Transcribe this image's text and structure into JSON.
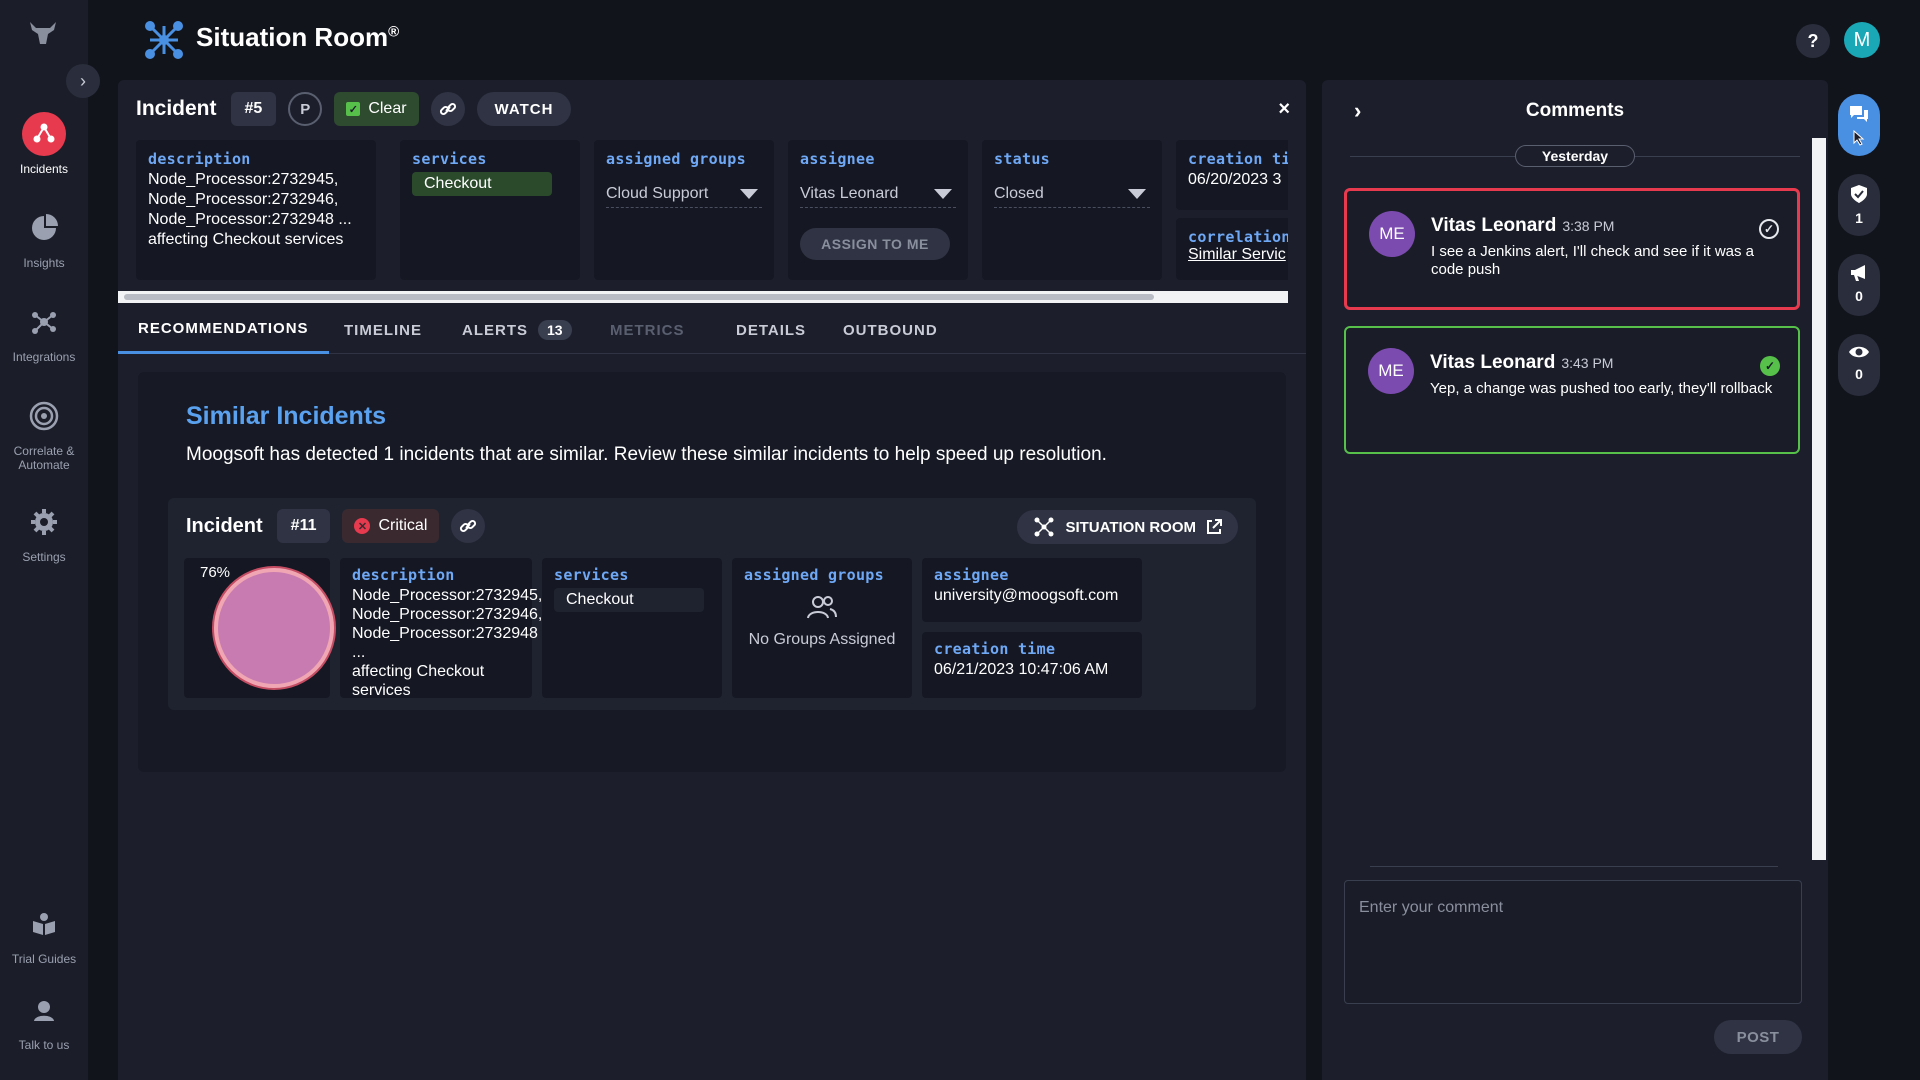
{
  "app": {
    "title": "Situation Room",
    "trademark": "®",
    "help_label": "?",
    "user_initial": "M"
  },
  "nav": {
    "items": [
      {
        "label": "Incidents",
        "icon": "incidents-icon",
        "active": true
      },
      {
        "label": "Insights",
        "icon": "pie-chart-icon"
      },
      {
        "label": "Integrations",
        "icon": "integrations-icon"
      },
      {
        "label": "Correlate &\nAutomate",
        "icon": "target-icon"
      },
      {
        "label": "Settings",
        "icon": "gear-icon"
      }
    ],
    "bottom": [
      {
        "label": "Trial Guides",
        "icon": "guide-icon"
      },
      {
        "label": "Talk to us",
        "icon": "support-icon"
      }
    ]
  },
  "incident": {
    "label": "Incident",
    "number": "#5",
    "priority": "P",
    "status_badge": "Clear",
    "watch_label": "WATCH",
    "close_label": "×",
    "fields": {
      "description_label": "description",
      "description_lines": [
        "Node_Processor:2732945,",
        "Node_Processor:2732946,",
        "Node_Processor:2732948 ...",
        "affecting Checkout services"
      ],
      "services_label": "services",
      "services_value": "Checkout",
      "groups_label": "assigned groups",
      "groups_value": "Cloud Support",
      "assignee_label": "assignee",
      "assignee_value": "Vitas Leonard",
      "assign_me_label": "ASSIGN TO ME",
      "status_label": "status",
      "status_value": "Closed",
      "creation_label": "creation ti",
      "creation_value": "06/20/2023 3",
      "correlation_label": "correlation",
      "correlation_value": "Similar Servic"
    }
  },
  "tabs": [
    {
      "label": "RECOMMENDATIONS",
      "active": true
    },
    {
      "label": "TIMELINE"
    },
    {
      "label": "ALERTS",
      "count": "13"
    },
    {
      "label": "METRICS",
      "disabled": true
    },
    {
      "label": "DETAILS"
    },
    {
      "label": "OUTBOUND"
    }
  ],
  "recommendations": {
    "title": "Similar Incidents",
    "description": "Moogsoft has detected 1 incidents that are similar. Review these similar incidents to help speed up resolution.",
    "similar": {
      "label": "Incident",
      "number": "#11",
      "severity": "Critical",
      "situation_room_label": "SITUATION ROOM",
      "similarity": "76%",
      "similarity_value": 0.76,
      "description_label": "description",
      "description_lines": [
        "Node_Processor:2732945,",
        "Node_Processor:2732946,",
        "Node_Processor:2732948 ...",
        "affecting Checkout services"
      ],
      "services_label": "services",
      "services_value": "Checkout",
      "groups_label": "assigned groups",
      "groups_value": "No Groups Assigned",
      "assignee_label": "assignee",
      "assignee_value": "university@moogsoft.com",
      "creation_label": "creation time",
      "creation_value": "06/21/2023 10:47:06 AM"
    }
  },
  "comments": {
    "title": "Comments",
    "day_label": "Yesterday",
    "items": [
      {
        "initials": "ME",
        "author": "Vitas Leonard",
        "time": "3:38 PM",
        "text": "I see a Jenkins alert, I'll check and see if it was a code push",
        "resolved": false
      },
      {
        "initials": "ME",
        "author": "Vitas Leonard",
        "time": "3:43 PM",
        "text": "Yep, a change was pushed too early, they'll rollback",
        "resolved": true
      }
    ],
    "input_placeholder": "Enter your comment",
    "post_label": "POST"
  },
  "rail": [
    {
      "icon": "comments-icon",
      "count": "",
      "active": true
    },
    {
      "icon": "shield-check-icon",
      "count": "1"
    },
    {
      "icon": "megaphone-icon",
      "count": "0"
    },
    {
      "icon": "eye-icon",
      "count": "0"
    }
  ]
}
